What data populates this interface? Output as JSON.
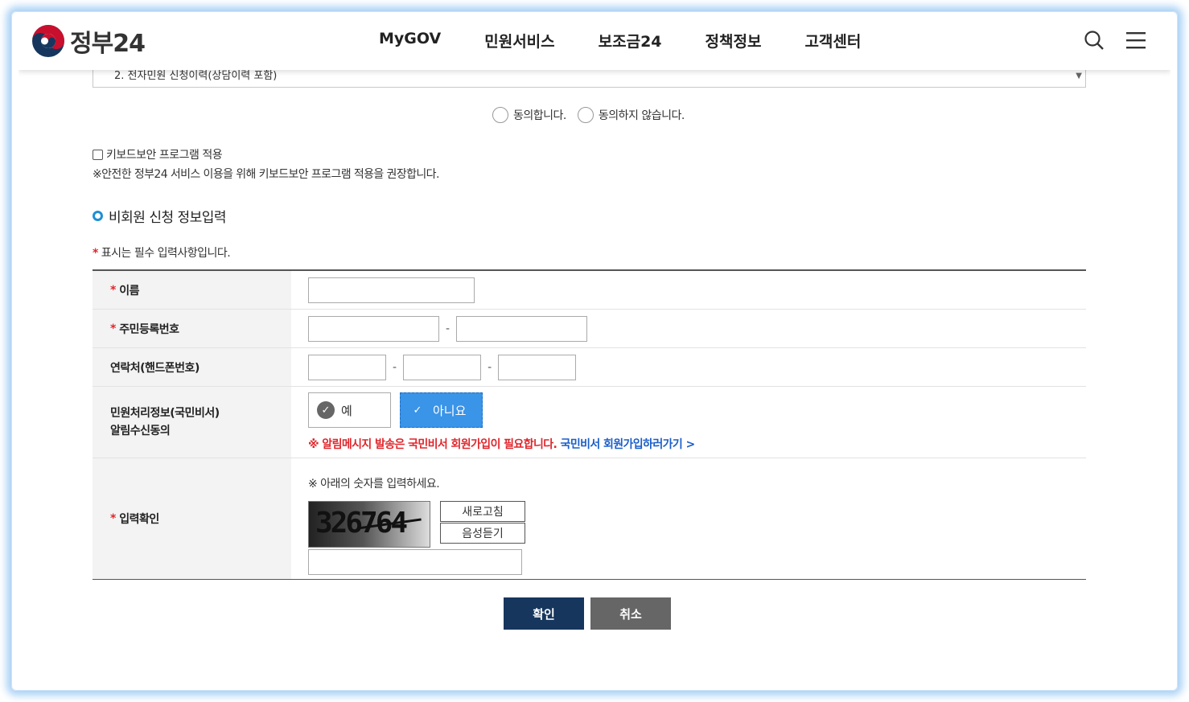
{
  "header": {
    "logo_text": "정부24",
    "nav": [
      "MyGOV",
      "민원서비스",
      "보조금24",
      "정책정보",
      "고객센터"
    ],
    "icons": {
      "search": "search-icon",
      "menu": "hamburger-menu-icon"
    }
  },
  "terms": {
    "visible_line": "2. 전자민원 신청이력(상담이력 포함)"
  },
  "consent": {
    "agree_label": "동의합니다.",
    "disagree_label": "동의하지 않습니다."
  },
  "keyboard_security": {
    "label": "키보드보안 프로그램 적용",
    "note": "※안전한 정부24 서비스 이용을 위해 키보드보안 프로그램 적용을 권장합니다."
  },
  "section": {
    "title": "비회원 신청 정보입력",
    "required_note": "표시는 필수 입력사항입니다."
  },
  "form": {
    "name_label": "이름",
    "rrn_label": "주민등록번호",
    "phone_label": "연락처(핸드폰번호)",
    "notify_label_1": "민원처리정보(국민비서)",
    "notify_label_2": "알림수신동의",
    "yes_label": "예",
    "no_label": "아니요",
    "notice_red": "※ 알림메시지 발송은 국민비서 회원가입이 필요합니다.",
    "notice_link": "국민비서 회원가입하러가기 >",
    "captcha_label": "입력확인",
    "captcha_note": "※ 아래의 숫자를 입력하세요.",
    "captcha_code": "326764",
    "refresh_label": "새로고침",
    "audio_label": "음성듣기"
  },
  "actions": {
    "confirm_label": "확인",
    "cancel_label": "취소"
  },
  "colors": {
    "accent_blue": "#3a94e8",
    "primary_navy": "#16365e",
    "required_red": "#e0262c",
    "link_blue": "#1a5ec9"
  }
}
